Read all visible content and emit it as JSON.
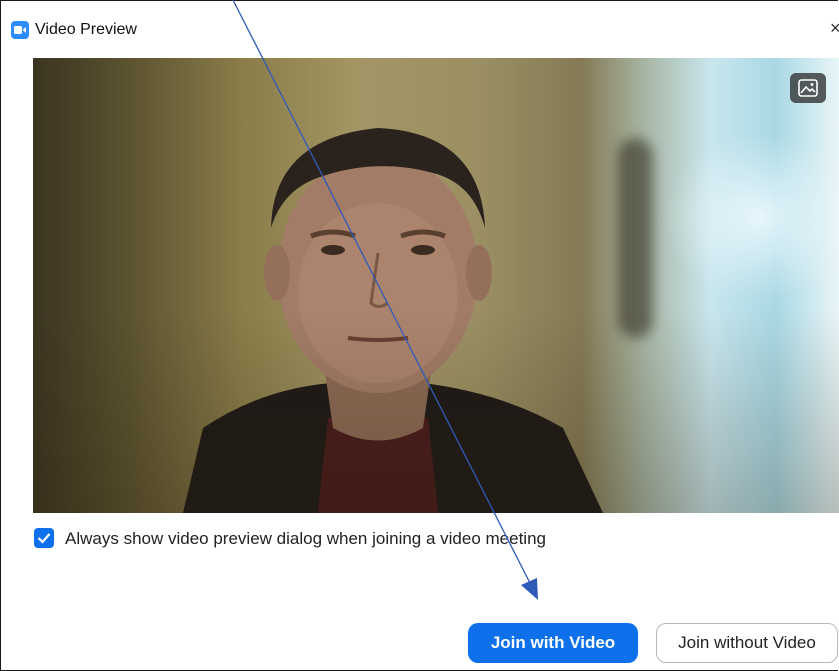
{
  "window": {
    "title": "Video Preview",
    "app_icon": "zoom-camera-icon",
    "close_glyph": "×"
  },
  "preview": {
    "background_button_icon": "image-icon"
  },
  "options": {
    "always_show_label": "Always show video preview dialog when joining a video meeting",
    "always_show_checked": true
  },
  "actions": {
    "join_with_video": "Join with Video",
    "join_without_video": "Join without Video"
  },
  "colors": {
    "accent": "#0e71eb",
    "app_icon": "#2d8cff",
    "annotation_arrow": "#2f5bb7"
  }
}
